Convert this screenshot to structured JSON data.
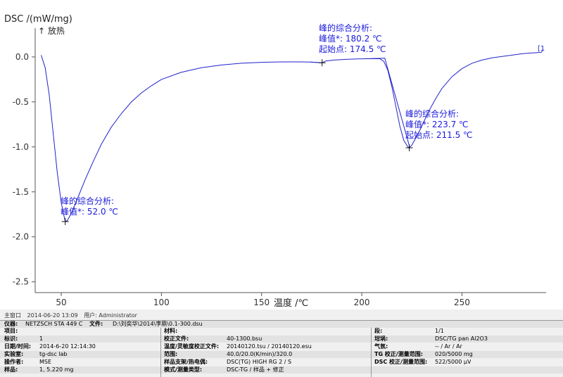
{
  "header": {
    "ylabel": "DSC /(mW/mg)",
    "exo_label": "↑ 放热",
    "xlabel": "温度 /℃",
    "end_marker": "[1"
  },
  "annotations": [
    {
      "title": "峰的综合分析:",
      "lines": [
        "峰值*:   180.2 ℃",
        "起始点:  174.5 ℃"
      ]
    },
    {
      "title": "峰的综合分析:",
      "lines": [
        "峰值*:    223.7 ℃",
        "起始点:  211.5 ℃"
      ]
    },
    {
      "title": "峰的综合分析:",
      "lines": [
        "峰值*:  52.0 ℃"
      ]
    }
  ],
  "chart_data": {
    "type": "line",
    "xlabel": "温度 /℃",
    "ylabel": "DSC /(mW/mg)",
    "xlim": [
      37,
      292
    ],
    "ylim": [
      -2.62,
      0.32
    ],
    "x_ticks": [
      50,
      100,
      150,
      200,
      250
    ],
    "y_ticks": [
      0.0,
      -0.5,
      -1.0,
      -1.5,
      -2.0,
      -2.5
    ],
    "x_tick_labels": [
      "50",
      "100",
      "150",
      "200",
      "250"
    ],
    "y_tick_labels": [
      "0.0",
      "-0.5",
      "-1.0",
      "-1.5",
      "-2.0",
      "-2.5"
    ],
    "grid": false,
    "series": [
      {
        "color": "#2222cc",
        "points": [
          [
            40,
            0.02
          ],
          [
            42,
            -0.12
          ],
          [
            44,
            -0.42
          ],
          [
            46,
            -0.85
          ],
          [
            48,
            -1.28
          ],
          [
            50,
            -1.62
          ],
          [
            51.5,
            -1.78
          ],
          [
            52.0,
            -1.83
          ],
          [
            53,
            -1.82
          ],
          [
            55,
            -1.74
          ],
          [
            58,
            -1.58
          ],
          [
            62,
            -1.36
          ],
          [
            66,
            -1.16
          ],
          [
            70,
            -0.97
          ],
          [
            75,
            -0.78
          ],
          [
            80,
            -0.63
          ],
          [
            85,
            -0.5
          ],
          [
            90,
            -0.4
          ],
          [
            95,
            -0.32
          ],
          [
            100,
            -0.25
          ],
          [
            110,
            -0.17
          ],
          [
            120,
            -0.12
          ],
          [
            130,
            -0.09
          ],
          [
            140,
            -0.07
          ],
          [
            150,
            -0.06
          ],
          [
            160,
            -0.055
          ],
          [
            170,
            -0.055
          ],
          [
            174.5,
            -0.058
          ],
          [
            178,
            -0.062
          ],
          [
            180.2,
            -0.065
          ],
          [
            182,
            -0.045
          ],
          [
            186,
            -0.035
          ],
          [
            192,
            -0.027
          ],
          [
            198,
            -0.022
          ],
          [
            203,
            -0.02
          ],
          [
            207,
            -0.02
          ],
          [
            209,
            -0.02
          ],
          [
            211,
            -0.05
          ],
          [
            213,
            -0.15
          ],
          [
            215,
            -0.33
          ],
          [
            217,
            -0.55
          ],
          [
            219,
            -0.77
          ],
          [
            221,
            -0.93
          ],
          [
            223,
            -1.0
          ],
          [
            223.7,
            -1.01
          ],
          [
            225,
            -0.98
          ],
          [
            228,
            -0.86
          ],
          [
            231,
            -0.72
          ],
          [
            234,
            -0.58
          ],
          [
            237,
            -0.46
          ],
          [
            240,
            -0.35
          ],
          [
            245,
            -0.22
          ],
          [
            250,
            -0.13
          ],
          [
            255,
            -0.07
          ],
          [
            260,
            -0.035
          ],
          [
            265,
            -0.01
          ],
          [
            270,
            0.005
          ],
          [
            275,
            0.02
          ],
          [
            280,
            0.035
          ],
          [
            285,
            0.045
          ],
          [
            289.5,
            0.05
          ],
          [
            290.5,
            0.08
          ]
        ]
      }
    ],
    "onset_tangents": [
      {
        "points": [
          [
            174.5,
            -0.058
          ],
          [
            180.2,
            -0.065
          ]
        ]
      },
      {
        "points": [
          [
            202,
            -0.02
          ],
          [
            211.5,
            -0.015
          ],
          [
            224,
            -1.01
          ]
        ]
      }
    ],
    "marked_points": [
      {
        "x": 52.0,
        "y": -1.83
      },
      {
        "x": 180.2,
        "y": -0.065
      },
      {
        "x": 223.7,
        "y": -1.01
      }
    ]
  },
  "status_bar": {
    "label": "主窗口",
    "datetime": "2014-06-20 13:09",
    "user": "用户: Administrator"
  },
  "info_table": {
    "row1": {
      "instrument_label": "仪器:",
      "instrument_value": "NETZSCH STA 449 C",
      "file_label": "文件:",
      "file_value": "D:\\刘奕华\\2014\\李鼎\\0.1-300.dsu"
    },
    "col1": [
      {
        "label": "项目:",
        "value": ""
      },
      {
        "label": "标识:",
        "value": "1"
      },
      {
        "label": "日期/时间:",
        "value": "2014-6-20 12:14:30"
      },
      {
        "label": "实验室:",
        "value": "tg-dsc lab"
      },
      {
        "label": "操作者:",
        "value": "MSE"
      },
      {
        "label": "样品:",
        "value": "1, 5.220 mg"
      }
    ],
    "col2": [
      {
        "label": "材料:",
        "value": ""
      },
      {
        "label": "校正文件:",
        "value": "40-1300.bsu"
      },
      {
        "label": "温度/灵敏度校正文件:",
        "value": "20140120.tsu / 20140120.esu"
      },
      {
        "label": "范围:",
        "value": "40.0/20.0(K/min)/320.0"
      },
      {
        "label": "样品支架/热电偶:",
        "value": "DSC(TG) HIGH RG 2 / S"
      },
      {
        "label": "模式/测量类型:",
        "value": "DSC-TG / 样品 + 修正"
      }
    ],
    "col3": [
      {
        "label": "段:",
        "value": "1/1"
      },
      {
        "label": "坩埚:",
        "value": "DSC/TG pan Al2O3"
      },
      {
        "label": "气氛:",
        "value": "-- / Ar / Ar"
      },
      {
        "label": "TG 校正/测量范围:",
        "value": "020/5000 mg"
      },
      {
        "label": "DSC 校正/测量范围:",
        "value": "522/5000 μV"
      },
      {
        "label": "",
        "value": ""
      }
    ]
  }
}
